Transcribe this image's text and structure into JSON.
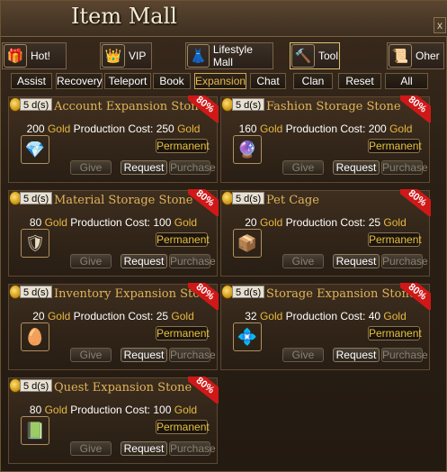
{
  "window": {
    "title": "Item Mall",
    "close_label": "x"
  },
  "categories": [
    {
      "label": "Hot!",
      "icon": "gift-icon",
      "glyph": "🎁"
    },
    {
      "label": "VIP",
      "icon": "crown-icon",
      "glyph": "👑"
    },
    {
      "label": "Lifestyle Mall",
      "icon": "clothing-icon",
      "glyph": "👗"
    },
    {
      "label": "Tool",
      "icon": "hammer-icon",
      "glyph": "🔨"
    },
    {
      "label": "Oher",
      "icon": "scroll-icon",
      "glyph": "📜"
    }
  ],
  "tabs": [
    "Assist",
    "Recovery",
    "Teleport",
    "Book",
    "Expansion",
    "Chat",
    "Clan",
    "Reset",
    "All"
  ],
  "active_tab": "Expansion",
  "strings": {
    "gold": "Gold",
    "production_cost": "Production Cost:",
    "permanent": "Permanent",
    "give": "Give",
    "request": "Request",
    "purchase": "Purchase"
  },
  "items": [
    {
      "name": "Account Expansion Stone",
      "days": "5 d(s)",
      "discount": "80%",
      "price": "200",
      "cost": "250",
      "icon": "sapphire-icon",
      "glyph": "💎"
    },
    {
      "name": "Fashion Storage Stone",
      "days": "5 d(s)",
      "discount": "80%",
      "price": "160",
      "cost": "200",
      "icon": "crystal-icon",
      "glyph": "🔮"
    },
    {
      "name": "Material Storage Stone",
      "days": "5 d(s)",
      "discount": "80%",
      "price": "80",
      "cost": "100",
      "icon": "helmet-icon",
      "glyph": "🛡"
    },
    {
      "name": "Pet Cage",
      "days": "5 d(s)",
      "discount": "80%",
      "price": "20",
      "cost": "25",
      "icon": "cage-icon",
      "glyph": "📦"
    },
    {
      "name": "Inventory Expansion Stone",
      "days": "5 d(s)",
      "discount": "80%",
      "price": "20",
      "cost": "25",
      "icon": "egg-icon",
      "glyph": "🥚"
    },
    {
      "name": "Storage Expansion Stone",
      "days": "5 d(s)",
      "discount": "80%",
      "price": "32",
      "cost": "40",
      "icon": "gem-pile-icon",
      "glyph": "💠"
    },
    {
      "name": "Quest Expansion Stone",
      "days": "5 d(s)",
      "discount": "80%",
      "price": "80",
      "cost": "100",
      "icon": "book-icon",
      "glyph": "📗"
    }
  ]
}
